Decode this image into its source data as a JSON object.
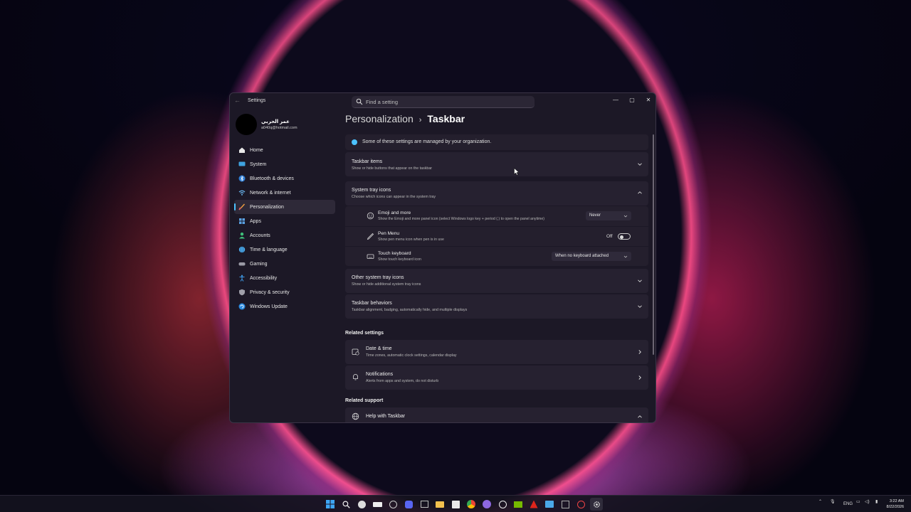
{
  "window": {
    "app_title": "Settings",
    "search_placeholder": "Find a setting",
    "minimize": "—",
    "maximize": "▢",
    "close": "✕"
  },
  "profile": {
    "name": "عمر الحربي",
    "email": "a040q@hotmail.com"
  },
  "nav": {
    "items": [
      {
        "label": "Home",
        "icon": "home-icon"
      },
      {
        "label": "System",
        "icon": "monitor-icon"
      },
      {
        "label": "Bluetooth & devices",
        "icon": "bluetooth-icon"
      },
      {
        "label": "Network & internet",
        "icon": "wifi-icon"
      },
      {
        "label": "Personalization",
        "icon": "brush-icon"
      },
      {
        "label": "Apps",
        "icon": "apps-icon"
      },
      {
        "label": "Accounts",
        "icon": "person-icon"
      },
      {
        "label": "Time & language",
        "icon": "globe-icon"
      },
      {
        "label": "Gaming",
        "icon": "controller-icon"
      },
      {
        "label": "Accessibility",
        "icon": "accessibility-icon"
      },
      {
        "label": "Privacy & security",
        "icon": "shield-icon"
      },
      {
        "label": "Windows Update",
        "icon": "update-icon"
      }
    ],
    "active": "Personalization"
  },
  "breadcrumb": {
    "parent": "Personalization",
    "separator": "›",
    "current": "Taskbar"
  },
  "info": {
    "text": "Some of these settings are managed by your organization."
  },
  "sections": {
    "taskbar_items": {
      "title": "Taskbar items",
      "subtitle": "Show or hide buttons that appear on the taskbar"
    },
    "system_tray": {
      "title": "System tray icons",
      "subtitle": "Choose which icons can appear in the system tray",
      "rows": [
        {
          "title": "Emoji and more",
          "subtitle": "Show the Emoji and more panel icon (select Windows logo key + period (.) to open the panel anytime)",
          "control": "Never"
        },
        {
          "title": "Pen Menu",
          "subtitle": "Show pen menu icon when pen is in use",
          "control": "Off"
        },
        {
          "title": "Touch keyboard",
          "subtitle": "Show touch keyboard icon",
          "control": "When no keyboard attached"
        }
      ]
    },
    "other_tray": {
      "title": "Other system tray icons",
      "subtitle": "Show or hide additional system tray icons"
    },
    "behaviors": {
      "title": "Taskbar behaviors",
      "subtitle": "Taskbar alignment, badging, automatically hide, and multiple displays"
    }
  },
  "related_settings": {
    "heading": "Related settings",
    "items": [
      {
        "title": "Date & time",
        "subtitle": "Time zones, automatic clock settings, calendar display"
      },
      {
        "title": "Notifications",
        "subtitle": "Alerts from apps and system, do not disturb"
      }
    ]
  },
  "related_support": {
    "heading": "Related support",
    "items": [
      {
        "title": "Help with Taskbar"
      }
    ]
  },
  "taskbar": {
    "tray": {
      "lang": "ENG",
      "time": "3:22 AM",
      "date": "8/22/2026"
    }
  },
  "colors": {
    "accent": "#4cc2ff",
    "window_bg": "#1c1826",
    "card_bg": "#262130"
  }
}
